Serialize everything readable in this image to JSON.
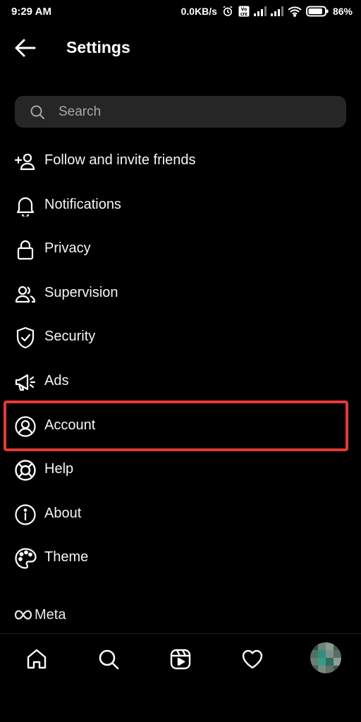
{
  "status_bar": {
    "time": "9:29 AM",
    "network_speed": "0.0KB/s",
    "battery_percent": "86%",
    "icons": [
      "alarm-icon",
      "volte-icon",
      "signal-icon",
      "signal-icon",
      "wifi-icon",
      "battery-icon"
    ]
  },
  "header": {
    "title": "Settings",
    "back_icon": "arrow-left-icon"
  },
  "search": {
    "placeholder": "Search",
    "value": "",
    "icon": "search-icon"
  },
  "menu": {
    "items": [
      {
        "label": "Follow and invite friends",
        "icon": "add-person-icon"
      },
      {
        "label": "Notifications",
        "icon": "bell-icon"
      },
      {
        "label": "Privacy",
        "icon": "lock-icon"
      },
      {
        "label": "Supervision",
        "icon": "people-icon"
      },
      {
        "label": "Security",
        "icon": "shield-check-icon"
      },
      {
        "label": "Ads",
        "icon": "megaphone-icon"
      },
      {
        "label": "Account",
        "icon": "user-circle-icon",
        "highlighted": true
      },
      {
        "label": "Help",
        "icon": "lifebuoy-icon"
      },
      {
        "label": "About",
        "icon": "info-icon"
      },
      {
        "label": "Theme",
        "icon": "palette-icon"
      }
    ]
  },
  "highlight_color": "#e53935",
  "meta": {
    "brand": "Meta",
    "icon": "meta-infinity-icon"
  },
  "bottom_nav": {
    "items": [
      "home-icon",
      "search-icon",
      "reels-icon",
      "heart-icon",
      "profile-avatar"
    ]
  },
  "colors": {
    "background": "#000000",
    "search_background": "#262626",
    "text": "#f5f5f5",
    "placeholder": "#a8a8a8"
  }
}
